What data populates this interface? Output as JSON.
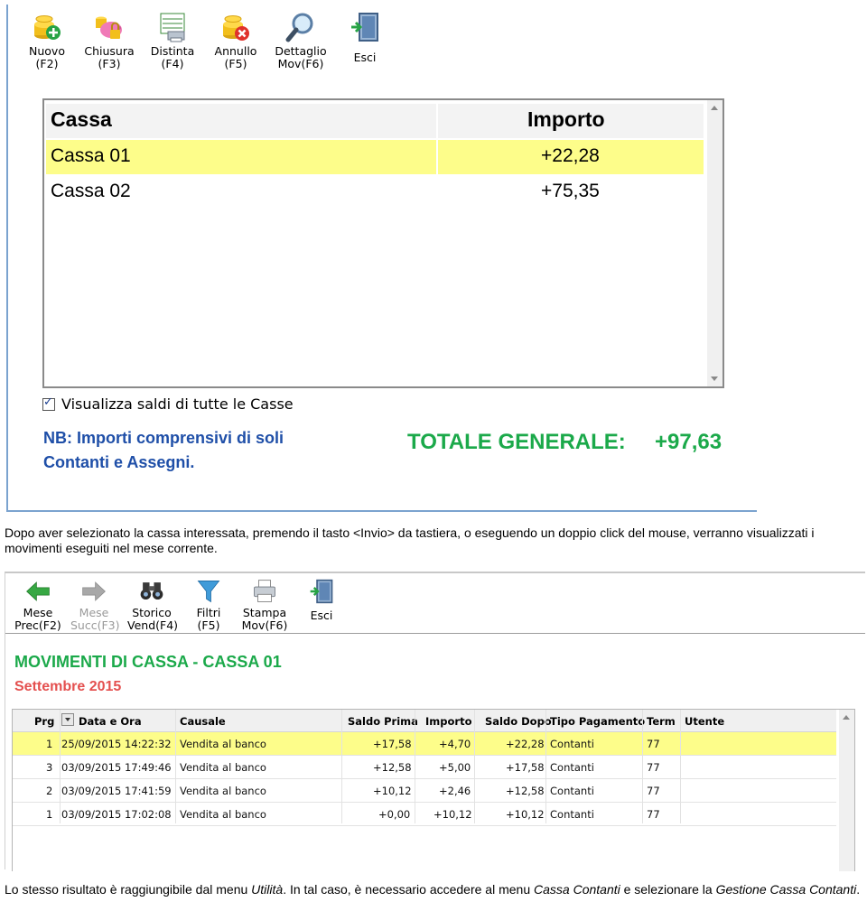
{
  "screen1": {
    "toolbar": [
      {
        "label": "Nuovo\n(F2)",
        "icon": "coins-add-icon"
      },
      {
        "label": "Chiusura\n(F3)",
        "icon": "piggy-bank-lock-icon"
      },
      {
        "label": "Distinta\n(F4)",
        "icon": "document-print-icon"
      },
      {
        "label": "Annullo\n(F5)",
        "icon": "coins-cancel-icon"
      },
      {
        "label": "Dettaglio\nMov(F6)",
        "icon": "magnifier-icon"
      },
      {
        "label": "Esci",
        "icon": "exit-door-icon"
      }
    ],
    "table": {
      "headers": {
        "cassa": "Cassa",
        "importo": "Importo"
      },
      "rows": [
        {
          "cassa": "Cassa 01",
          "importo": "+22,28",
          "selected": true
        },
        {
          "cassa": "Cassa 02",
          "importo": "+75,35",
          "selected": false
        }
      ]
    },
    "checkbox_label": "Visualizza saldi di tutte le Casse",
    "checkbox_checked": true,
    "note_line1": "NB: Importi comprensivi di soli",
    "note_line2": "Contanti e Assegni.",
    "total_label": "TOTALE GENERALE:",
    "total_value": "+97,63",
    "colors": {
      "selected_row": "#fdfd8a",
      "total_green": "#1ba94a",
      "note_blue": "#1f4fa8"
    }
  },
  "paragraph1": "Dopo aver selezionato la cassa interessata, premendo il tasto <Invio> da tastiera, o eseguendo un doppio click del mouse, verranno visualizzati i movimenti eseguiti nel mese corrente.",
  "screen2": {
    "toolbar": [
      {
        "label": "Mese\nPrec(F2)",
        "icon": "arrow-left-icon",
        "disabled": false
      },
      {
        "label": "Mese\nSucc(F3)",
        "icon": "arrow-right-icon",
        "disabled": true
      },
      {
        "label": "Storico\nVend(F4)",
        "icon": "binoculars-icon",
        "disabled": false
      },
      {
        "label": "Filtri\n(F5)",
        "icon": "funnel-icon",
        "disabled": false
      },
      {
        "label": "Stampa\nMov(F6)",
        "icon": "printer-icon",
        "disabled": false
      },
      {
        "label": "Esci",
        "icon": "exit-door-icon",
        "disabled": false
      }
    ],
    "title": "MOVIMENTI DI CASSA - CASSA 01",
    "month": "Settembre 2015",
    "table": {
      "headers": {
        "prg": "Prg",
        "data": "Data e Ora",
        "causale": "Causale",
        "saldo_prima": "Saldo Prima",
        "importo": "Importo",
        "saldo_dopo": "Saldo Dopo",
        "tipo": "Tipo Pagamento",
        "term": "Term",
        "utente": "Utente"
      },
      "rows": [
        {
          "prg": "1",
          "data": "25/09/2015 14:22:32",
          "causale": "Vendita al banco",
          "saldo_prima": "+17,58",
          "importo": "+4,70",
          "saldo_dopo": "+22,28",
          "tipo": "Contanti",
          "term": "77",
          "utente": "",
          "selected": true
        },
        {
          "prg": "3",
          "data": "03/09/2015 17:49:46",
          "causale": "Vendita al banco",
          "saldo_prima": "+12,58",
          "importo": "+5,00",
          "saldo_dopo": "+17,58",
          "tipo": "Contanti",
          "term": "77",
          "utente": "",
          "selected": false
        },
        {
          "prg": "2",
          "data": "03/09/2015 17:41:59",
          "causale": "Vendita al banco",
          "saldo_prima": "+10,12",
          "importo": "+2,46",
          "saldo_dopo": "+12,58",
          "tipo": "Contanti",
          "term": "77",
          "utente": "",
          "selected": false
        },
        {
          "prg": "1",
          "data": "03/09/2015 17:02:08",
          "causale": "Vendita al banco",
          "saldo_prima": "+0,00",
          "importo": "+10,12",
          "saldo_dopo": "+10,12",
          "tipo": "Contanti",
          "term": "77",
          "utente": "",
          "selected": false
        }
      ]
    },
    "colors": {
      "title_green": "#1ba94a",
      "month_red": "#e4504f",
      "selected_row": "#fdfd8a"
    }
  },
  "paragraph2": {
    "a": "Lo stesso risultato è raggiungibile dal menu ",
    "b": "Utilità",
    "c": ". In tal caso, è necessario accedere al menu ",
    "d": "Cassa Contanti",
    "e": " e selezionare la ",
    "f": "Gestione Cassa Contanti",
    "g": "."
  }
}
